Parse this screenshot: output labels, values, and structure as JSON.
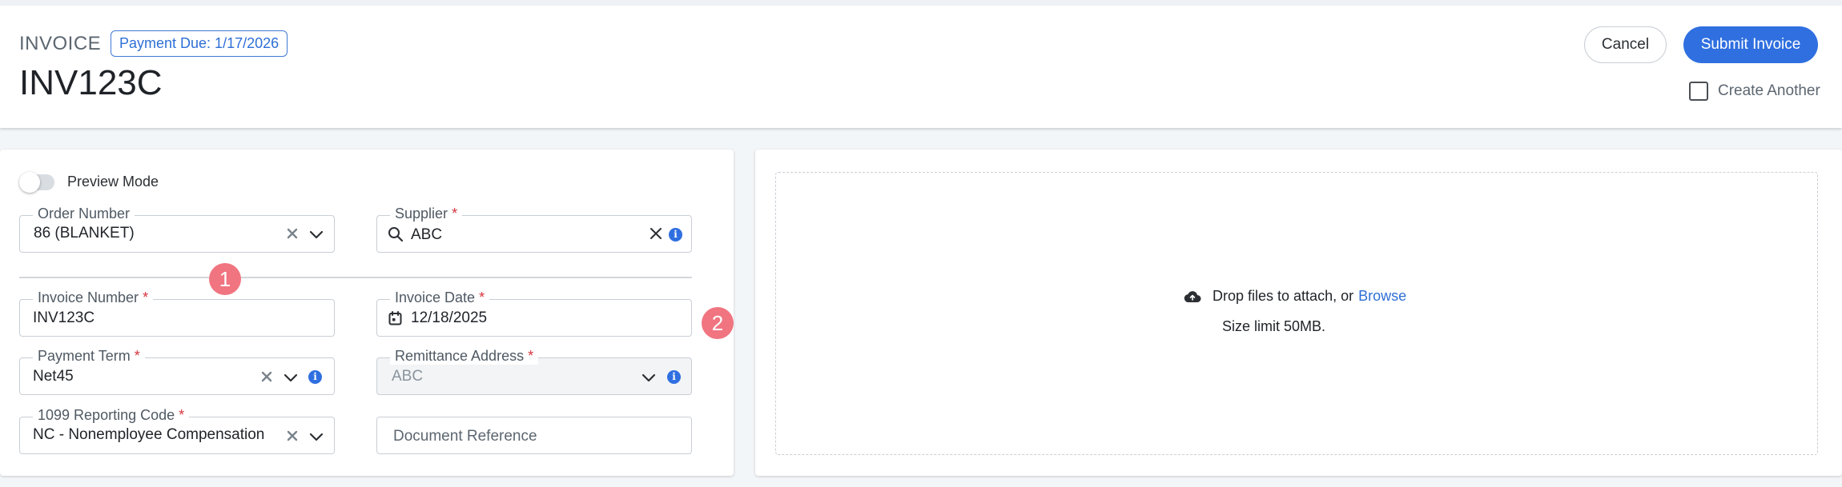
{
  "header": {
    "doc_type": "INVOICE",
    "due_badge": "Payment Due: 1/17/2026",
    "doc_number": "INV123C",
    "cancel_label": "Cancel",
    "submit_label": "Submit Invoice",
    "create_another_label": "Create Another",
    "create_another_checked": false
  },
  "form": {
    "preview_mode_label": "Preview Mode",
    "preview_mode_on": false,
    "order_number": {
      "label": "Order Number",
      "value": "86 (BLANKET)"
    },
    "supplier": {
      "label": "Supplier",
      "required_mark": "*",
      "value": "ABC"
    },
    "invoice_number": {
      "label": "Invoice Number",
      "required_mark": "*",
      "value": "INV123C"
    },
    "invoice_date": {
      "label": "Invoice Date",
      "required_mark": "*",
      "value": "12/18/2025"
    },
    "payment_term": {
      "label": "Payment Term",
      "required_mark": "*",
      "value": "Net45"
    },
    "remittance_address": {
      "label": "Remittance Address",
      "required_mark": "*",
      "value": "ABC"
    },
    "reporting_code": {
      "label": "1099 Reporting Code",
      "required_mark": "*",
      "value": "NC - Nonemployee Compensation"
    },
    "document_reference": {
      "placeholder": "Document Reference"
    }
  },
  "markers": [
    "1",
    "2"
  ],
  "attachments": {
    "drop_text": "Drop files to attach, or",
    "browse_label": "Browse",
    "size_limit": "Size limit 50MB."
  },
  "icons": {
    "clear": "close-icon",
    "dropdown": "chevron-down-icon",
    "search": "search-icon",
    "info": "info-icon",
    "calendar": "calendar-icon",
    "upload": "cloud-upload-icon"
  },
  "colors": {
    "accent": "#2f6fe0",
    "required": "#d6333d",
    "marker": "#f07581"
  }
}
